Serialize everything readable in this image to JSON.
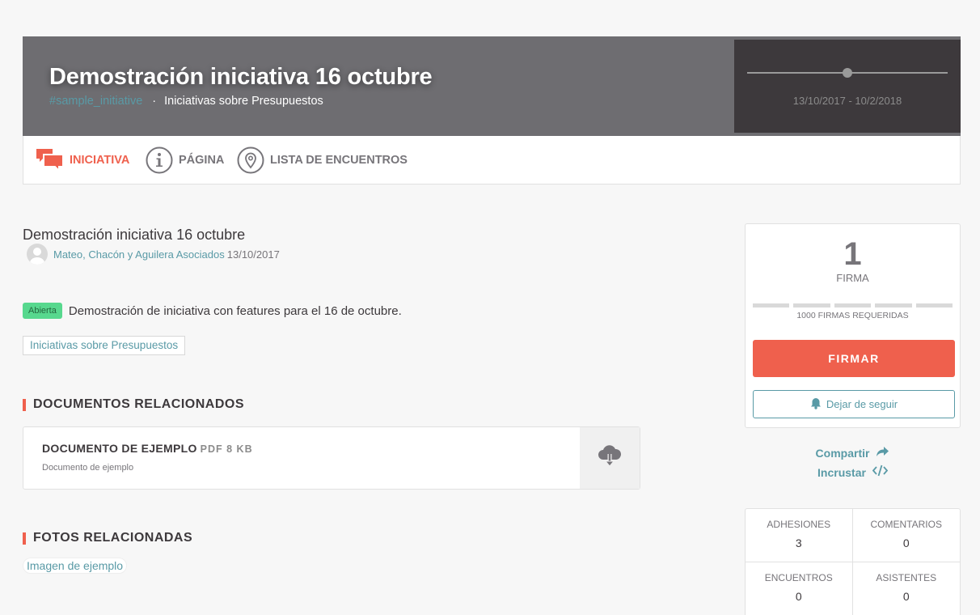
{
  "header": {
    "title": "Demostración iniciativa 16 octubre",
    "hashtag": "#sample_initiative",
    "separator": "·",
    "scope": "Iniciativas sobre Presupuestos",
    "dates": "13/10/2017 - 10/2/2018",
    "timeline_progress": 0.5
  },
  "tabs": [
    {
      "label": "Iniciativa",
      "icon": "speech-bubbles-icon",
      "active": true
    },
    {
      "label": "Página",
      "icon": "info-icon",
      "active": false
    },
    {
      "label": "Lista de encuentros",
      "icon": "map-pin-icon",
      "active": false
    }
  ],
  "initiative": {
    "title": "Demostración iniciativa 16 octubre",
    "author": "Mateo, Chacón y Aguilera Asociados",
    "date": "13/10/2017",
    "status": "Abierta",
    "description": "Demostración de iniciativa con features para el 16 de octubre.",
    "tag": "Iniciativas sobre Presupuestos"
  },
  "documents": {
    "heading": "Documentos relacionados",
    "items": [
      {
        "title": "Documento de ejemplo",
        "meta": "PDF 8 KB",
        "description": "Documento de ejemplo",
        "download_icon": "cloud-download-icon"
      }
    ]
  },
  "photos": {
    "heading": "Fotos relacionadas",
    "items": [
      {
        "label": "Imagen de ejemplo"
      }
    ]
  },
  "support": {
    "count": "1",
    "count_label": "Firma",
    "required_label": "1000 firmas requeridas",
    "sign_button": "Firmar",
    "follow_button": "Dejar de seguir",
    "follow_icon": "bell-icon"
  },
  "share": {
    "share_label": "Compartir",
    "share_icon": "share-arrow-icon",
    "embed_label": "Incrustar",
    "embed_icon": "code-icon"
  },
  "stats": [
    {
      "label": "Adhesiones",
      "value": "3"
    },
    {
      "label": "Comentarios",
      "value": "0"
    },
    {
      "label": "Encuentros",
      "value": "0"
    },
    {
      "label": "Asistentes",
      "value": "0"
    }
  ],
  "colors": {
    "accent": "#ef604d",
    "link": "#599aa6",
    "hero_bg": "#6e6d71",
    "dates_bg": "#3d393c",
    "status_badge": "#57d88e"
  }
}
